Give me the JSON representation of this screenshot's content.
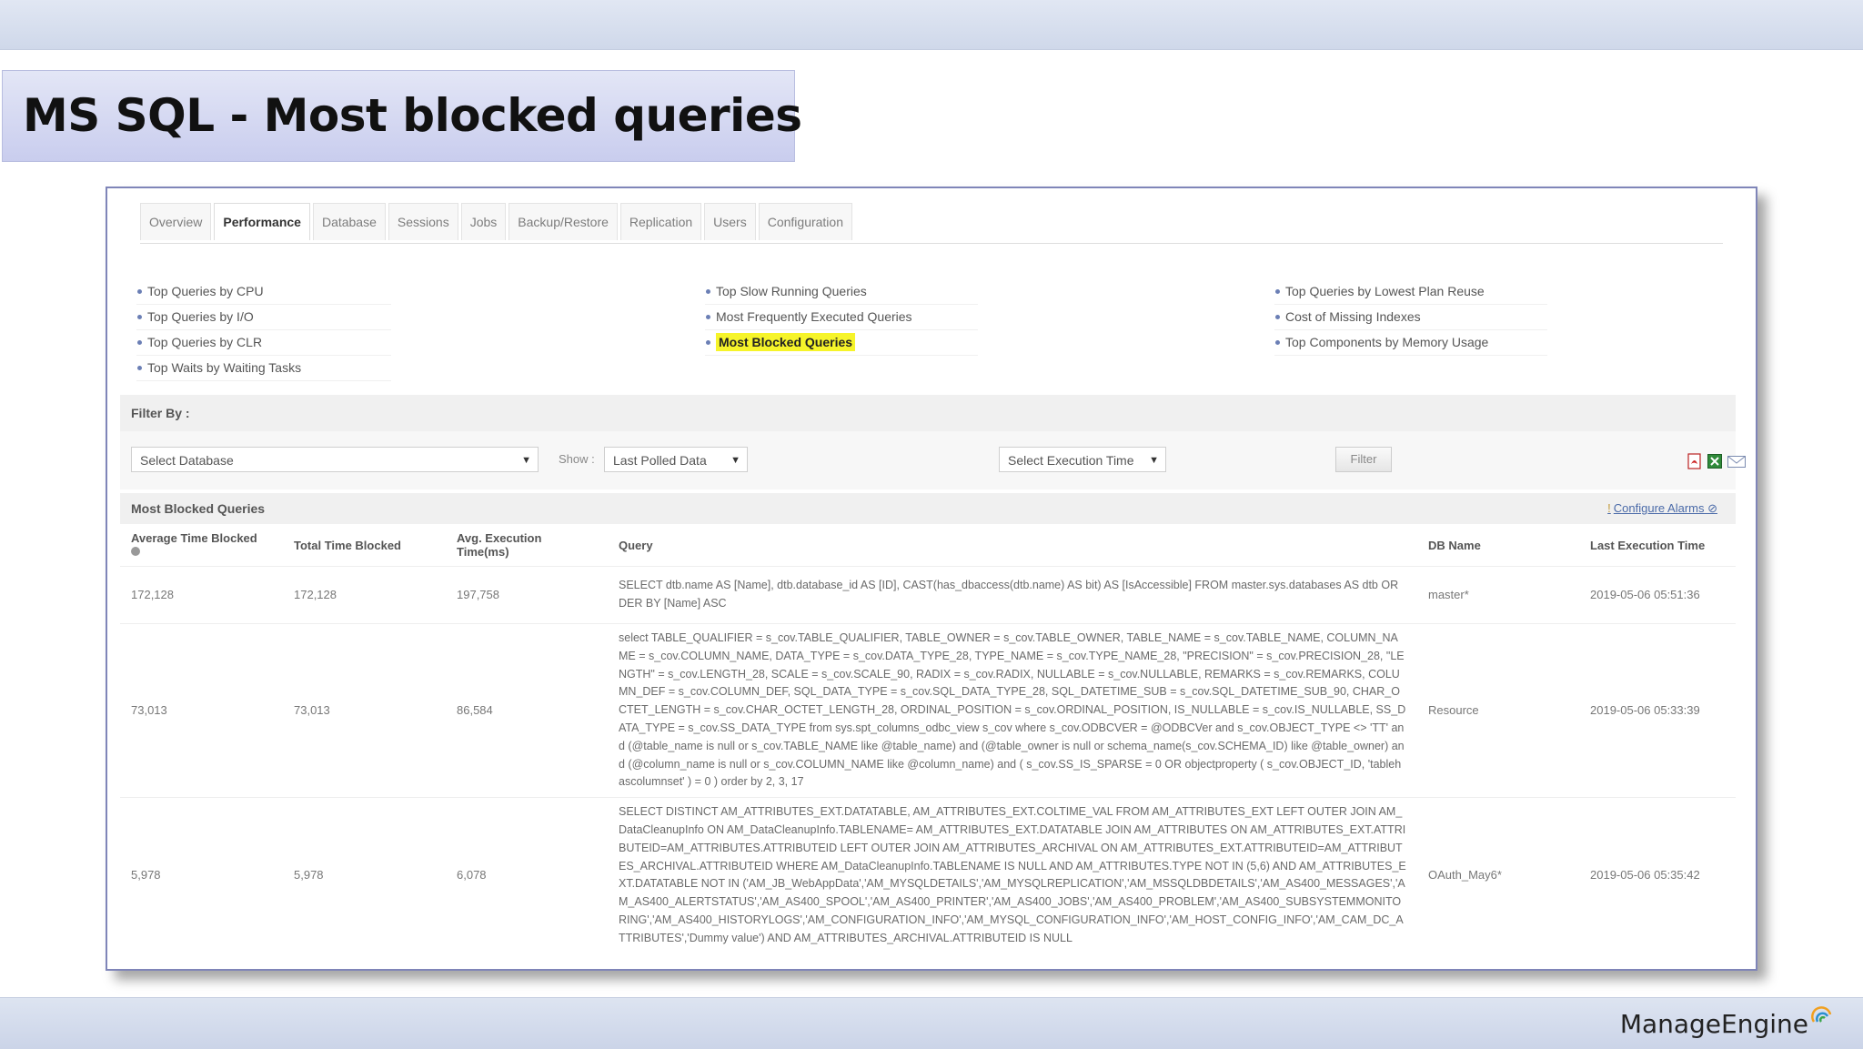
{
  "slide": {
    "title": "MS SQL - Most blocked queries",
    "brand": "ManageEngine"
  },
  "tabs": [
    {
      "label": "Overview",
      "active": false
    },
    {
      "label": "Performance",
      "active": true
    },
    {
      "label": "Database",
      "active": false
    },
    {
      "label": "Sessions",
      "active": false
    },
    {
      "label": "Jobs",
      "active": false
    },
    {
      "label": "Backup/Restore",
      "active": false
    },
    {
      "label": "Replication",
      "active": false
    },
    {
      "label": "Users",
      "active": false
    },
    {
      "label": "Configuration",
      "active": false
    }
  ],
  "links": {
    "col1": [
      "Top Queries by CPU",
      "Top Queries by I/O",
      "Top Queries by CLR",
      "Top Waits by Waiting Tasks"
    ],
    "col2": [
      "Top Slow Running Queries",
      "Most Frequently Executed Queries",
      "Most Blocked Queries"
    ],
    "col3": [
      "Top Queries by Lowest Plan Reuse",
      "Cost of Missing Indexes",
      "Top Components by Memory Usage"
    ],
    "highlighted": "Most Blocked Queries"
  },
  "filter": {
    "heading": "Filter By :",
    "database_select": "Select Database",
    "show_label": "Show :",
    "show_select": "Last Polled Data",
    "execution_select": "Select Execution Time",
    "filter_button": "Filter"
  },
  "table": {
    "heading": "Most Blocked Queries",
    "configure_alarms": "Configure Alarms",
    "columns": [
      "Average Time Blocked",
      "Total Time Blocked",
      "Avg. Execution Time(ms)",
      "Query",
      "DB Name",
      "Last Execution Time"
    ],
    "rows": [
      {
        "avg_blocked": "172,128",
        "total_blocked": "172,128",
        "avg_exec": "197,758",
        "query": "SELECT dtb.name AS [Name], dtb.database_id AS [ID], CAST(has_dbaccess(dtb.name) AS bit) AS [IsAccessible] FROM master.sys.databases AS dtb ORDER BY [Name] ASC",
        "db_name": "master*",
        "last_exec": "2019-05-06 05:51:36"
      },
      {
        "avg_blocked": "73,013",
        "total_blocked": "73,013",
        "avg_exec": "86,584",
        "query": "select TABLE_QUALIFIER = s_cov.TABLE_QUALIFIER, TABLE_OWNER = s_cov.TABLE_OWNER, TABLE_NAME = s_cov.TABLE_NAME, COLUMN_NAME = s_cov.COLUMN_NAME, DATA_TYPE = s_cov.DATA_TYPE_28, TYPE_NAME = s_cov.TYPE_NAME_28, \"PRECISION\" = s_cov.PRECISION_28, \"LENGTH\" = s_cov.LENGTH_28, SCALE = s_cov.SCALE_90, RADIX = s_cov.RADIX, NULLABLE = s_cov.NULLABLE, REMARKS = s_cov.REMARKS, COLUMN_DEF = s_cov.COLUMN_DEF, SQL_DATA_TYPE = s_cov.SQL_DATA_TYPE_28, SQL_DATETIME_SUB = s_cov.SQL_DATETIME_SUB_90, CHAR_OCTET_LENGTH = s_cov.CHAR_OCTET_LENGTH_28, ORDINAL_POSITION = s_cov.ORDINAL_POSITION, IS_NULLABLE = s_cov.IS_NULLABLE, SS_DATA_TYPE = s_cov.SS_DATA_TYPE from sys.spt_columns_odbc_view s_cov where s_cov.ODBCVER = @ODBCVer and s_cov.OBJECT_TYPE <> 'TT' and (@table_name is null or s_cov.TABLE_NAME like @table_name) and (@table_owner is null or schema_name(s_cov.SCHEMA_ID) like @table_owner) and (@column_name is null or s_cov.COLUMN_NAME like @column_name) and ( s_cov.SS_IS_SPARSE = 0 OR objectproperty ( s_cov.OBJECT_ID, 'tablehascolumnset' ) = 0 ) order by 2, 3, 17",
        "db_name": "Resource",
        "last_exec": "2019-05-06 05:33:39"
      },
      {
        "avg_blocked": "5,978",
        "total_blocked": "5,978",
        "avg_exec": "6,078",
        "query": "SELECT DISTINCT AM_ATTRIBUTES_EXT.DATATABLE, AM_ATTRIBUTES_EXT.COLTIME_VAL FROM AM_ATTRIBUTES_EXT LEFT OUTER JOIN AM_DataCleanupInfo ON AM_DataCleanupInfo.TABLENAME= AM_ATTRIBUTES_EXT.DATATABLE JOIN AM_ATTRIBUTES ON AM_ATTRIBUTES_EXT.ATTRIBUTEID=AM_ATTRIBUTES.ATTRIBUTEID LEFT OUTER JOIN AM_ATTRIBUTES_ARCHIVAL ON AM_ATTRIBUTES_EXT.ATTRIBUTEID=AM_ATTRIBUTES_ARCHIVAL.ATTRIBUTEID WHERE AM_DataCleanupInfo.TABLENAME IS NULL AND AM_ATTRIBUTES.TYPE NOT IN (5,6) AND AM_ATTRIBUTES_EXT.DATATABLE NOT IN ('AM_JB_WebAppData','AM_MYSQLDETAILS','AM_MYSQLREPLICATION','AM_MSSQLDBDETAILS','AM_AS400_MESSAGES','AM_AS400_ALERTSTATUS','AM_AS400_SPOOL','AM_AS400_PRINTER','AM_AS400_JOBS','AM_AS400_PROBLEM','AM_AS400_SUBSYSTEMMONITORING','AM_AS400_HISTORYLOGS','AM_CONFIGURATION_INFO','AM_MYSQL_CONFIGURATION_INFO','AM_HOST_CONFIG_INFO','AM_CAM_DC_ATTRIBUTES','Dummy value') AND AM_ATTRIBUTES_ARCHIVAL.ATTRIBUTEID IS NULL",
        "db_name": "OAuth_May6*",
        "last_exec": "2019-05-06 05:35:42"
      }
    ]
  },
  "colors": {
    "highlight": "#f6f42a",
    "frame_border": "#7f85b8",
    "title_bg": "#c9cdee",
    "link": "#4a6aa8"
  }
}
